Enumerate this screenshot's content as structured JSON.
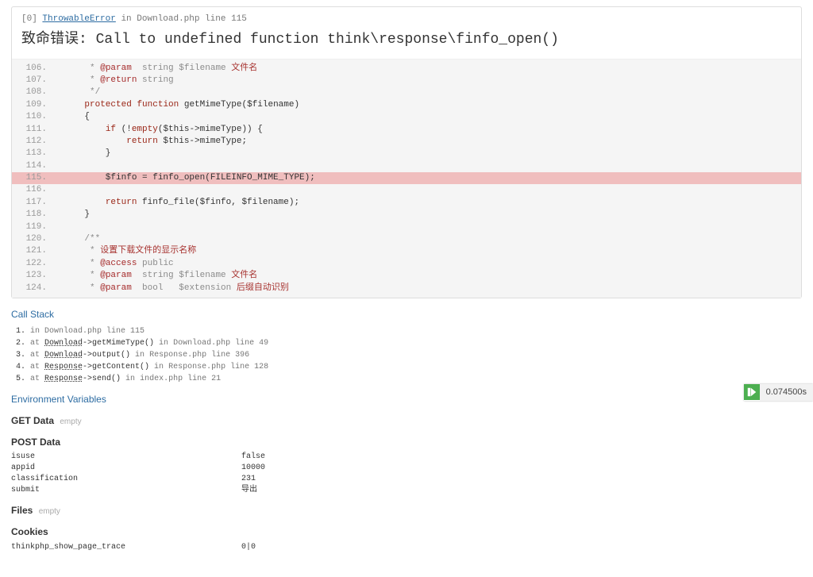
{
  "error": {
    "index": "[0]",
    "exception": "ThrowableError",
    "in": "in",
    "file": "Download.php line 115",
    "title_prefix": "致命错误: ",
    "title_msg": "Call to undefined function think\\response\\finfo_open()"
  },
  "code": {
    "start": 106,
    "highlight": 115,
    "lines": [
      "     * @param  string $filename 文件名",
      "     * @return string",
      "     */",
      "    protected function getMimeType($filename)",
      "    {",
      "        if (!empty($this->mimeType)) {",
      "            return $this->mimeType;",
      "        }",
      "",
      "        $finfo = finfo_open(FILEINFO_MIME_TYPE);",
      "",
      "        return finfo_file($finfo, $filename);",
      "    }",
      "",
      "    /**",
      "     * 设置下载文件的显示名称",
      "     * @access public",
      "     * @param  string $filename 文件名",
      "     * @param  bool   $extension 后缀自动识别"
    ]
  },
  "stack": {
    "title": "Call Stack",
    "items": [
      {
        "at": "in",
        "cls": "",
        "method": "",
        "loc": "Download.php line 115"
      },
      {
        "at": "at",
        "cls": "Download",
        "method": "->getMimeType()",
        "loc": "Download.php line 49"
      },
      {
        "at": "at",
        "cls": "Download",
        "method": "->output()",
        "loc": "Response.php line 396"
      },
      {
        "at": "at",
        "cls": "Response",
        "method": "->getContent()",
        "loc": "Response.php line 128"
      },
      {
        "at": "at",
        "cls": "Response",
        "method": "->send()",
        "loc": "index.php line 21"
      }
    ]
  },
  "env": {
    "title": "Environment Variables",
    "get": {
      "label": "GET Data",
      "empty": "empty"
    },
    "post": {
      "label": "POST Data",
      "rows": [
        {
          "k": "isuse",
          "v": "false"
        },
        {
          "k": "appid",
          "v": "10000"
        },
        {
          "k": "classification",
          "v": "231"
        },
        {
          "k": "submit",
          "v": "导出"
        }
      ]
    },
    "files": {
      "label": "Files",
      "empty": "empty"
    },
    "cookies": {
      "label": "Cookies",
      "rows": [
        {
          "k": "thinkphp_show_page_trace",
          "v": "0|0"
        }
      ]
    }
  },
  "profiler": {
    "time": "0.074500s"
  }
}
